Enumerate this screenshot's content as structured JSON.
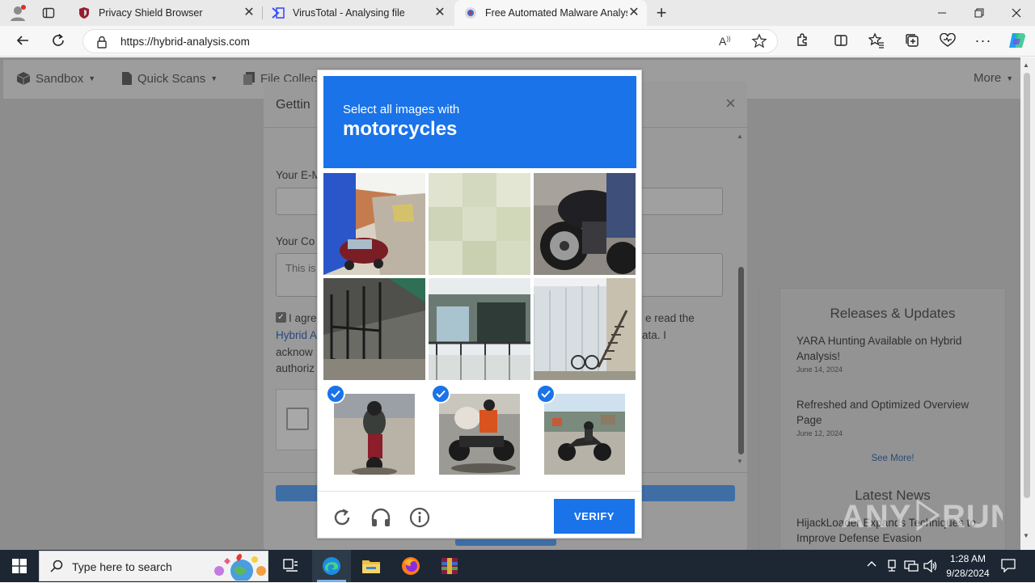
{
  "browser": {
    "tabs": [
      {
        "title": "Privacy Shield Browser"
      },
      {
        "title": "VirusTotal - Analysing file"
      },
      {
        "title": "Free Automated Malware Analysi"
      }
    ],
    "url": "https://hybrid-analysis.com"
  },
  "site_nav": {
    "items": [
      "Sandbox",
      "Quick Scans",
      "File Collec"
    ],
    "more": "More"
  },
  "modal": {
    "title": "Gettin",
    "email_label": "Your E-M",
    "comment_label": "Your Co",
    "comment_placeholder": "This is",
    "agree_start": "I agre",
    "agree_end": "e read the",
    "link_text": "Hybrid A",
    "data_text": "ata. I",
    "ack_text": "acknow",
    "auth_text": "authoriz"
  },
  "sidebar": {
    "releases_title": "Releases & Updates",
    "items": [
      {
        "title": "YARA Hunting Available on Hybrid Analysis!",
        "date": "June 14, 2024"
      },
      {
        "title": "Refreshed and Optimized Overview Page",
        "date": "June 12, 2024"
      }
    ],
    "see_more": "See More!",
    "news_title": "Latest News",
    "news_item": "HijackLoader Expands Techniques to Improve Defense Evasion"
  },
  "captcha": {
    "instruction": "Select all images with",
    "target": "motorcycles",
    "verify_label": "VERIFY",
    "selected": [
      6,
      7,
      8
    ]
  },
  "taskbar": {
    "search_placeholder": "Type here to search",
    "time": "1:28 AM",
    "date": "9/28/2024"
  },
  "watermark": "ANY RUN"
}
